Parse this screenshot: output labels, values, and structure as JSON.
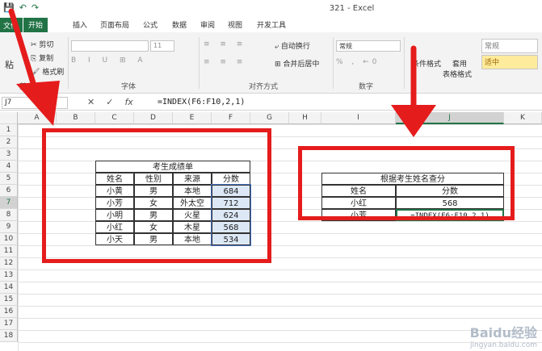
{
  "window": {
    "title": "321 - Excel"
  },
  "tabs": [
    "文件",
    "开始",
    "插入",
    "页面布局",
    "公式",
    "数据",
    "审阅",
    "视图",
    "开发工具"
  ],
  "ribbon": {
    "cut": "剪切",
    "copy": "复制",
    "format_painter": "格式刷",
    "paste": "粘",
    "clipboard_label": "剪",
    "font_label": "字体",
    "font_size": "11",
    "wrap_text": "自动换行",
    "merge_center": "合并后居中",
    "alignment_label": "对齐方式",
    "number_format": "常规",
    "number_label": "数字",
    "cond_format": "条件格式",
    "table_format_1": "套用",
    "table_format_2": "表格格式",
    "style_normal": "常规",
    "style_medium": "适中"
  },
  "formula_bar": {
    "name_box": "J7",
    "fx": "fx",
    "formula": "=INDEX(F6:F10,2,1)"
  },
  "columns": [
    "A",
    "B",
    "C",
    "D",
    "E",
    "F",
    "G",
    "H",
    "I",
    "J",
    "K"
  ],
  "rows": [
    "1",
    "2",
    "3",
    "4",
    "5",
    "6",
    "7",
    "8",
    "9",
    "10",
    "11",
    "12",
    "13",
    "14",
    "15",
    "16",
    "17",
    "18"
  ],
  "score_table": {
    "title": "考生成绩单",
    "headers": [
      "姓名",
      "性别",
      "来源",
      "分数"
    ],
    "rows": [
      [
        "小黄",
        "男",
        "本地",
        "684"
      ],
      [
        "小芳",
        "女",
        "外太空",
        "712"
      ],
      [
        "小明",
        "男",
        "火星",
        "624"
      ],
      [
        "小红",
        "女",
        "木星",
        "568"
      ],
      [
        "小天",
        "男",
        "本地",
        "534"
      ]
    ]
  },
  "lookup_table": {
    "title": "根据考生姓名查分",
    "headers": [
      "姓名",
      "分数"
    ],
    "rows": [
      [
        "小红",
        "568"
      ],
      [
        "小芳",
        "=INDEX(F6:F10,2,1)"
      ]
    ]
  },
  "watermark": {
    "logo": "Baidu经验",
    "url": "jingyan.baidu.com"
  },
  "colors": {
    "accent": "#217346",
    "annotation": "#e51c1c"
  }
}
